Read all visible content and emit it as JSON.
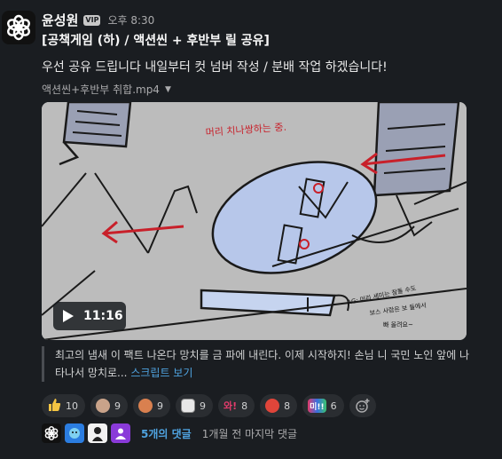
{
  "message": {
    "author": "윤성원",
    "badge": "VIP",
    "time": "오후 8:30",
    "title": "[공책게임 (하) / 액션씬 + 후반부 릴 공유]",
    "body": "우선 공유 드립니다 내일부터 컷 넘버 작성  / 분배 작업 하겠습니다!"
  },
  "attachment": {
    "filename": "액션씬+후반부 취합.mp4",
    "duration": "11:16",
    "drawing_text": {
      "top": "머리 치나쌍하는 중.",
      "bottom_lines": [
        "AG: 머리 세미는 잘돌 수도",
        "보스 사람은 보 들에서",
        "빠 올려요~"
      ]
    }
  },
  "transcript": {
    "text": "최고의 냄새 이 팩트 나온다 망치를 금 파에 내린다. 이제 시작하지! 손님 니 국민 노인 앞에 나타나서 망치로... ",
    "link_label": "스크립트 보기"
  },
  "reactions": [
    {
      "emoji": "thumbs-up",
      "count": "10",
      "color": "#f5c542"
    },
    {
      "emoji": "face-emoji-1",
      "count": "9",
      "color": "#c9a38a"
    },
    {
      "emoji": "face-emoji-2",
      "count": "9",
      "color": "#d9804f"
    },
    {
      "emoji": "face-emoji-3",
      "count": "9",
      "color": "#e8e8e8"
    },
    {
      "emoji": "text-emoji-wa",
      "label": "와!",
      "count": "8",
      "color": "#e23b6b"
    },
    {
      "emoji": "face-emoji-4",
      "count": "8",
      "color": "#e0453a"
    },
    {
      "emoji": "text-emoji-ghost",
      "label": "미!!",
      "count": "6",
      "color": "#3a6ee0"
    }
  ],
  "thread": {
    "reply_count": "5개의 댓글",
    "last_reply": "1개월 전 마지막 댓글"
  }
}
